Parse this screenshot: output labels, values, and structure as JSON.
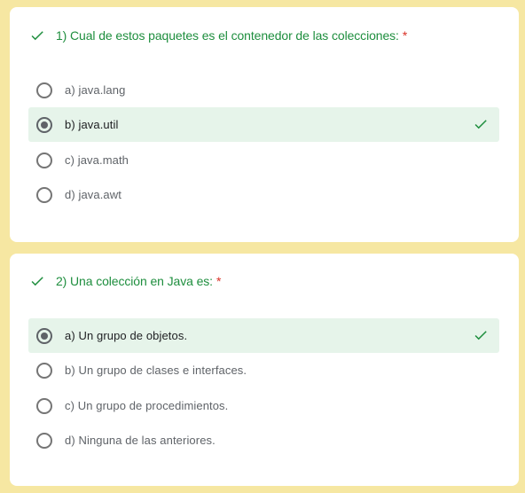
{
  "colors": {
    "page_bg": "#f6e7a2",
    "correct_green": "#1e8e3e",
    "selected_bg": "#e6f4ea",
    "required_red": "#d93025"
  },
  "questions": [
    {
      "title": "1) Cual de estos paquetes es el contenedor de las colecciones:",
      "required_mark": "*",
      "status_icon": "check-icon",
      "options": [
        {
          "label": "a) java.lang",
          "selected": false
        },
        {
          "label": "b) java.util",
          "selected": true,
          "correct_icon": "check-icon"
        },
        {
          "label": "c) java.math",
          "selected": false
        },
        {
          "label": "d) java.awt",
          "selected": false
        }
      ]
    },
    {
      "title": "2) Una colección en Java es:",
      "required_mark": "*",
      "status_icon": "check-icon",
      "options": [
        {
          "label": "a) Un grupo de objetos.",
          "selected": true,
          "correct_icon": "check-icon"
        },
        {
          "label": "b) Un grupo de clases e interfaces.",
          "selected": false
        },
        {
          "label": "c) Un grupo de procedimientos.",
          "selected": false
        },
        {
          "label": "d) Ninguna de las anteriores.",
          "selected": false
        }
      ]
    }
  ]
}
